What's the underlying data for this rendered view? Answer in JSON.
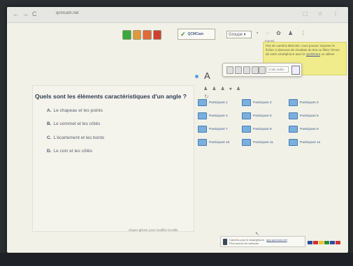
{
  "browser": {
    "nav_icons": [
      "←",
      "→",
      "C"
    ],
    "url": "qcmcam.net",
    "right_icons": [
      "⬚",
      "☆",
      "⋮"
    ]
  },
  "toolbar": {
    "button_colors": [
      "#3aa83a",
      "#e09a3a",
      "#e06a3a",
      "#d04030"
    ],
    "logo_text": "QCMCam",
    "groupe_label": "Groupe ▾",
    "top_icons": [
      "◔",
      "◌",
      "✿",
      "♟",
      "⋮"
    ],
    "full_hd": "Full HD"
  },
  "tooltip": {
    "text": "Pas de caméra détectée, vous pouvez importer le fichier ci-dessous de résultats du test ou filtrer l'écran de votre smartphone avec le",
    "link": "QCMCam",
    "suffix": "ou utiliser"
  },
  "float_toolbar": {
    "code_placeholder": "Code vidéo"
  },
  "question": {
    "letter": "A",
    "text": "Quels sont les éléments caractéristiques d'un angle ?",
    "answers": [
      {
        "letter": "A.",
        "text": "Le chapeau et les points"
      },
      {
        "letter": "B.",
        "text": "Le sommet et les côtés"
      },
      {
        "letter": "C.",
        "text": "L'écartement et les bords"
      },
      {
        "letter": "D.",
        "text": "Le coin et les côtés"
      }
    ],
    "hint": "cliquer-glisser pour modifier la taille"
  },
  "participants": [
    "Participant 1",
    "Participant 2",
    "Participant 3",
    "Participant 4",
    "Participant 5",
    "Participant 6",
    "Participant 7",
    "Participant 8",
    "Participant 9",
    "Participant 10",
    "Participant 11",
    "Participant 12"
  ],
  "banner": {
    "line1": "Caméra pour le smartphone :",
    "link": "app.qcmcam.net",
    "line2": "Plus besoin de webcam"
  },
  "flag_colors": [
    "#2a4aa0",
    "#d03030",
    "#f0c030",
    "#2a8a3a",
    "#2a4aa0",
    "#d03030"
  ]
}
